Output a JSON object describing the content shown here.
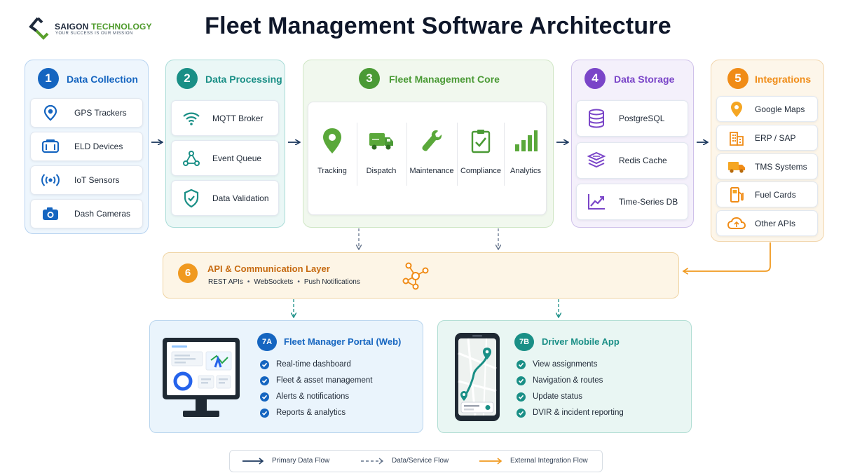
{
  "header": {
    "logo_name_a": "SAIGON",
    "logo_name_b": "TECHNOLOGY",
    "logo_tagline": "YOUR SUCCESS IS OUR MISSION",
    "title": "Fleet Management Software Architecture"
  },
  "colors": {
    "blue": "#1565c0",
    "teal": "#1a8f86",
    "green": "#4a9a35",
    "purple": "#7a45c8",
    "orange": "#f08c17",
    "api_orange": "#c66a10",
    "navy": "#1e3a5f"
  },
  "panels": {
    "data_collection": {
      "number": "1",
      "title": "Data Collection",
      "items": [
        {
          "label": "GPS Trackers",
          "icon": "location-pin-icon"
        },
        {
          "label": "ELD Devices",
          "icon": "eld-device-icon"
        },
        {
          "label": "IoT Sensors",
          "icon": "iot-signal-icon"
        },
        {
          "label": "Dash Cameras",
          "icon": "camera-icon"
        }
      ]
    },
    "data_processing": {
      "number": "2",
      "title": "Data Processing",
      "items": [
        {
          "label": "MQTT Broker",
          "icon": "wifi-icon"
        },
        {
          "label": "Event Queue",
          "icon": "node-network-icon"
        },
        {
          "label": "Data Validation",
          "icon": "shield-check-icon"
        }
      ]
    },
    "core": {
      "number": "3",
      "title": "Fleet Management Core",
      "items": [
        {
          "label": "Tracking",
          "icon": "location-pin-icon"
        },
        {
          "label": "Dispatch",
          "icon": "truck-icon"
        },
        {
          "label": "Maintenance",
          "icon": "wrench-icon"
        },
        {
          "label": "Compliance",
          "icon": "clipboard-check-icon"
        },
        {
          "label": "Analytics",
          "icon": "bar-chart-icon"
        }
      ]
    },
    "data_storage": {
      "number": "4",
      "title": "Data Storage",
      "items": [
        {
          "label": "PostgreSQL",
          "icon": "database-icon"
        },
        {
          "label": "Redis Cache",
          "icon": "layers-icon"
        },
        {
          "label": "Time-Series DB",
          "icon": "line-chart-icon"
        }
      ]
    },
    "integrations": {
      "number": "5",
      "title": "Integrations",
      "items": [
        {
          "label": "Google Maps",
          "icon": "map-pin-icon"
        },
        {
          "label": "ERP / SAP",
          "icon": "building-icon"
        },
        {
          "label": "TMS Systems",
          "icon": "truck-icon"
        },
        {
          "label": "Fuel Cards",
          "icon": "fuel-pump-icon"
        },
        {
          "label": "Other APIs",
          "icon": "cloud-icon"
        }
      ]
    }
  },
  "api_layer": {
    "number": "6",
    "title": "API & Communication Layer",
    "items": [
      "REST APIs",
      "WebSockets",
      "Push Notifications"
    ],
    "separator": "•"
  },
  "portal": {
    "number": "7A",
    "title": "Fleet Manager Portal (Web)",
    "features": [
      "Real-time dashboard",
      "Fleet & asset management",
      "Alerts & notifications",
      "Reports & analytics"
    ]
  },
  "mobile": {
    "number": "7B",
    "title": "Driver Mobile App",
    "features": [
      "View assignments",
      "Navigation & routes",
      "Update status",
      "DVIR & incident reporting"
    ]
  },
  "legend": {
    "primary": "Primary Data Flow",
    "service": "Data/Service Flow",
    "external": "External Integration Flow"
  }
}
